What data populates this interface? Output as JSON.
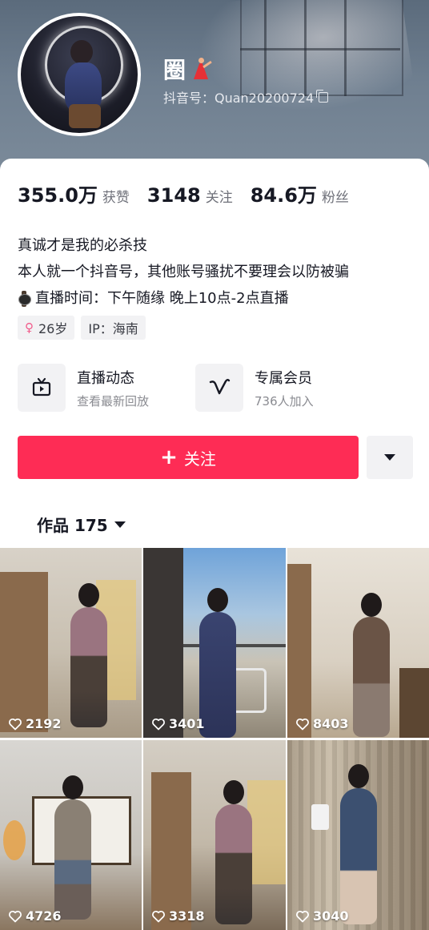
{
  "profile": {
    "name": "圈",
    "douyin_id": "抖音号：Quan20200724"
  },
  "stats": [
    {
      "num": "355.0万",
      "label": "获赞"
    },
    {
      "num": "3148",
      "label": "关注"
    },
    {
      "num": "84.6万",
      "label": "粉丝"
    }
  ],
  "bio": {
    "line1": "真诚才是我的必杀技",
    "line2": "本人就一个抖音号，其他账号骚扰不要理会以防被骗",
    "line3": "直播时间：下午随缘 晚上10点-2点直播"
  },
  "tags": {
    "age": "26岁",
    "ip": "IP：海南"
  },
  "features": {
    "live": {
      "title": "直播动态",
      "sub": "查看最新回放"
    },
    "member": {
      "title": "专属会员",
      "sub": "736人加入"
    }
  },
  "actions": {
    "follow_label": "关注"
  },
  "works_tab": {
    "label": "作品 175"
  },
  "videos": [
    {
      "likes": "2192"
    },
    {
      "likes": "3401"
    },
    {
      "likes": "8403"
    },
    {
      "likes": "4726"
    },
    {
      "likes": "3318"
    },
    {
      "likes": "3040"
    }
  ],
  "colors": {
    "accent": "#fe2c55",
    "tag_bg": "#f2f2f4"
  }
}
